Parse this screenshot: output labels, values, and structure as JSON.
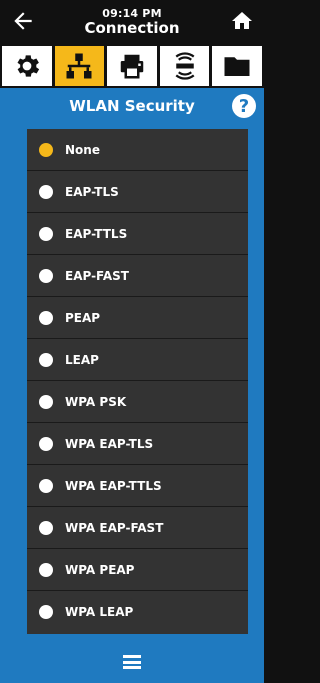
{
  "header": {
    "time": "09:14 PM",
    "title": "Connection",
    "back_icon": "arrow-left-icon",
    "home_icon": "home-icon"
  },
  "tabs": [
    {
      "name": "settings",
      "icon": "gear-icon",
      "active": false
    },
    {
      "name": "connection",
      "icon": "network-icon",
      "active": true
    },
    {
      "name": "print",
      "icon": "printer-icon",
      "active": false
    },
    {
      "name": "rfid",
      "icon": "rfid-icon",
      "active": false
    },
    {
      "name": "storage",
      "icon": "folder-icon",
      "active": false
    }
  ],
  "section": {
    "title": "WLAN Security",
    "help_label": "?"
  },
  "options": [
    {
      "label": "None",
      "selected": true
    },
    {
      "label": "EAP-TLS",
      "selected": false
    },
    {
      "label": "EAP-TTLS",
      "selected": false
    },
    {
      "label": "EAP-FAST",
      "selected": false
    },
    {
      "label": "PEAP",
      "selected": false
    },
    {
      "label": "LEAP",
      "selected": false
    },
    {
      "label": "WPA PSK",
      "selected": false
    },
    {
      "label": "WPA EAP-TLS",
      "selected": false
    },
    {
      "label": "WPA EAP-TTLS",
      "selected": false
    },
    {
      "label": "WPA EAP-FAST",
      "selected": false
    },
    {
      "label": "WPA PEAP",
      "selected": false
    },
    {
      "label": "WPA LEAP",
      "selected": false
    }
  ],
  "footer": {
    "menu_icon": "hamburger-menu-icon"
  },
  "colors": {
    "accent": "#f5b81a",
    "primary": "#1f7ac0",
    "list_bg": "#333333",
    "header_bg": "#111111"
  }
}
